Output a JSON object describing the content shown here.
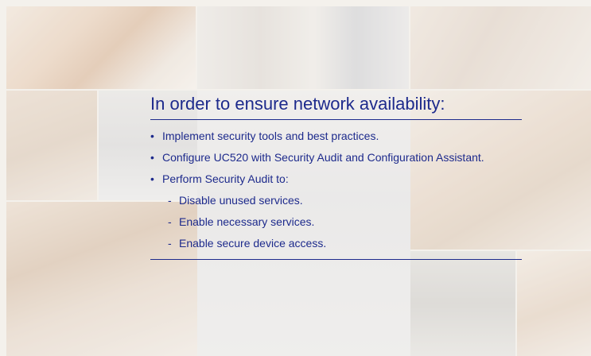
{
  "slide": {
    "title": "In order to ensure network availability:",
    "bullets": [
      {
        "level": 1,
        "marker": "•",
        "text": "Implement security tools and best practices."
      },
      {
        "level": 1,
        "marker": "•",
        "text": "Configure UC520 with Security Audit and Configuration Assistant."
      },
      {
        "level": 1,
        "marker": "•",
        "text": "Perform Security Audit to:"
      },
      {
        "level": 2,
        "marker": "-",
        "text": "Disable unused services."
      },
      {
        "level": 2,
        "marker": "-",
        "text": "Enable necessary services."
      },
      {
        "level": 2,
        "marker": "-",
        "text": "Enable secure device access."
      }
    ]
  },
  "colors": {
    "text": "#1d2a8c",
    "rule": "#1d2a8c"
  }
}
